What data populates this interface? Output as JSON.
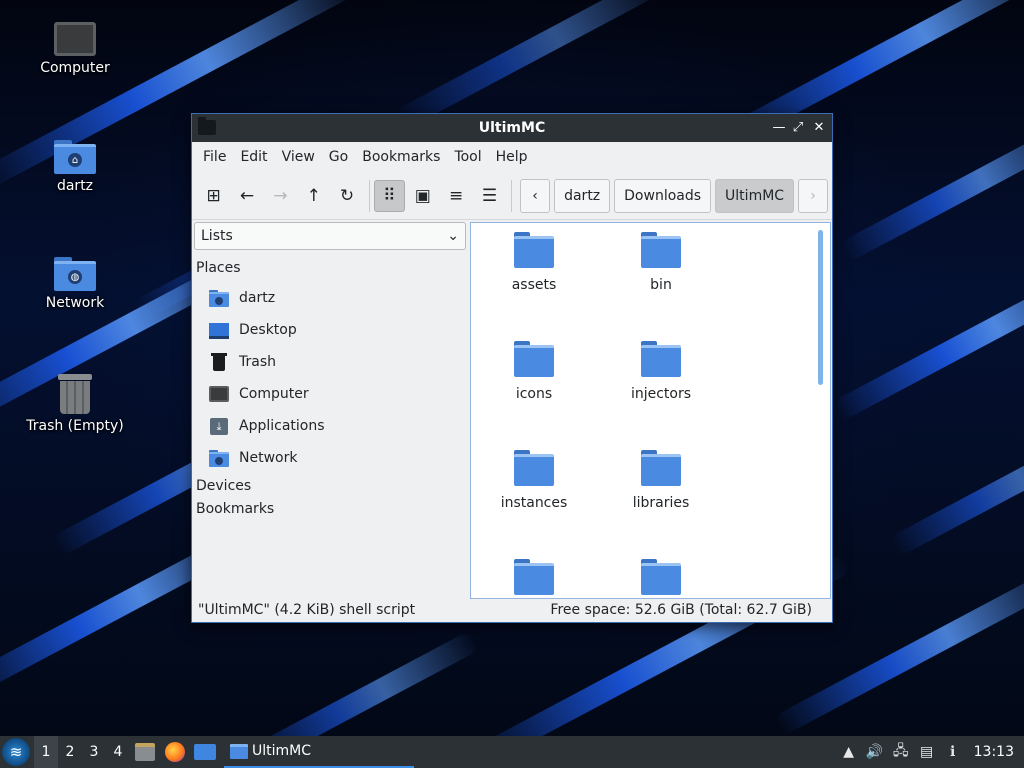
{
  "desktop": {
    "icons": [
      {
        "label": "Computer",
        "icon": "computer-icon"
      },
      {
        "label": "dartz",
        "icon": "home-folder-icon"
      },
      {
        "label": "Network",
        "icon": "network-folder-icon"
      },
      {
        "label": "Trash (Empty)",
        "icon": "trash-icon"
      }
    ]
  },
  "window": {
    "title": "UltimMC",
    "controls": {
      "minimize": "—",
      "maximize": "⤢",
      "close": "✕"
    },
    "menu": [
      "File",
      "Edit",
      "View",
      "Go",
      "Bookmarks",
      "Tool",
      "Help"
    ],
    "toolbar": {
      "new_tab": "⊞",
      "back": "←",
      "forward": "→",
      "up": "↑",
      "reload": "↻",
      "icon_view": "⠿",
      "thumbnail_view": "▣",
      "compact_view": "≡",
      "detail_view": "☰"
    },
    "breadcrumb": {
      "prev": "‹",
      "items": [
        "dartz",
        "Downloads",
        "UltimMC"
      ],
      "next": "›"
    },
    "sidebar": {
      "mode": "Lists",
      "dropdown_arrow": "⌄",
      "places_header": "Places",
      "places": [
        {
          "label": "dartz",
          "icon": "home-folder-icon"
        },
        {
          "label": "Desktop",
          "icon": "desktop-icon"
        },
        {
          "label": "Trash",
          "icon": "trash-icon"
        },
        {
          "label": "Computer",
          "icon": "computer-icon"
        },
        {
          "label": "Applications",
          "icon": "applications-icon"
        },
        {
          "label": "Network",
          "icon": "network-folder-icon"
        }
      ],
      "devices_header": "Devices",
      "bookmarks_header": "Bookmarks"
    },
    "files": [
      "assets",
      "bin",
      "icons",
      "injectors",
      "instances",
      "libraries",
      "",
      ""
    ],
    "status": {
      "selection": "\"UltimMC\" (4.2 KiB) shell script",
      "free_space": "Free space: 52.6 GiB (Total: 62.7 GiB)"
    }
  },
  "taskbar": {
    "start_icon": "≋",
    "workspaces": [
      "1",
      "2",
      "3",
      "4"
    ],
    "active_workspace": "1",
    "launchers": [
      "file-manager-icon",
      "firefox-icon",
      "show-desktop-icon"
    ],
    "task_label": "UltimMC",
    "tray": {
      "scroll": "▲",
      "volume": "🔊",
      "network": "🖧",
      "notes": "▤",
      "updates": "ℹ"
    },
    "clock": "13:13"
  },
  "colors": {
    "accent": "#3d8ee6",
    "titlebar": "#2b3135",
    "folder": "#4a8ae0"
  }
}
